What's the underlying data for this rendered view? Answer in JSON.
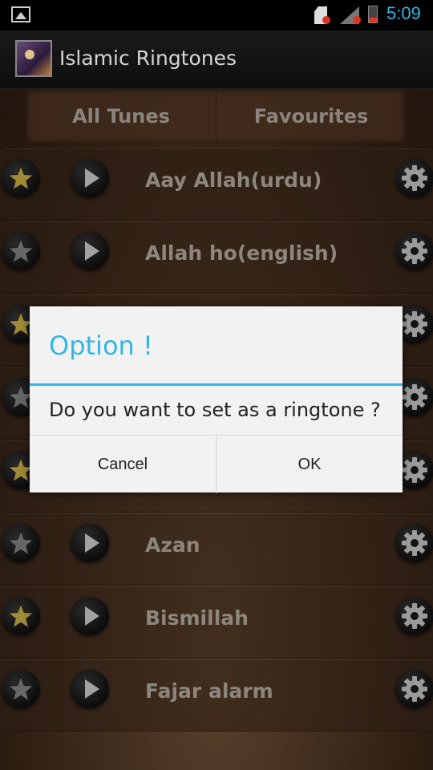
{
  "status_bar": {
    "time": "5:09"
  },
  "app_bar": {
    "title": "Islamic Ringtones"
  },
  "tabs": [
    {
      "label": "All Tunes"
    },
    {
      "label": "Favourites"
    }
  ],
  "list_items": [
    {
      "label": "Aay Allah(urdu)",
      "favourite": true
    },
    {
      "label": "Allah ho(english)",
      "favourite": false
    },
    {
      "label": "",
      "favourite": true
    },
    {
      "label": "",
      "favourite": false
    },
    {
      "label": "",
      "favourite": true
    },
    {
      "label": "Azan",
      "favourite": false
    },
    {
      "label": "Bismillah",
      "favourite": true
    },
    {
      "label": "Fajar alarm",
      "favourite": false
    }
  ],
  "dialog": {
    "title": "Option !",
    "message": "Do you want to set as a ringtone ?",
    "cancel_label": "Cancel",
    "ok_label": "OK"
  },
  "colors": {
    "accent": "#33b5e5",
    "star_active": "#d4b84a",
    "star_inactive": "#8a8a8a"
  }
}
